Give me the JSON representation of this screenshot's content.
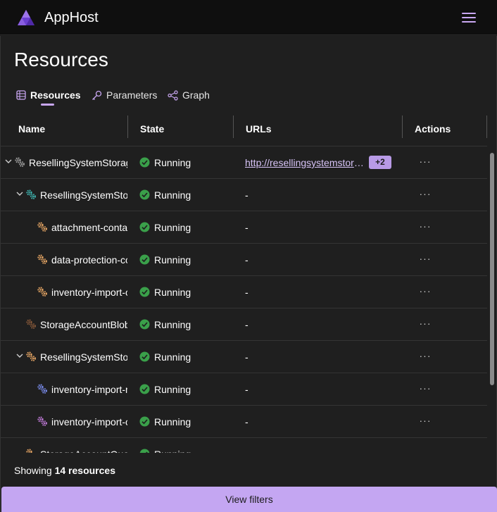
{
  "app": {
    "title": "AppHost"
  },
  "page": {
    "title": "Resources"
  },
  "tabs": [
    {
      "label": "Resources",
      "icon": "table-icon",
      "active": true
    },
    {
      "label": "Parameters",
      "icon": "key-icon",
      "active": false
    },
    {
      "label": "Graph",
      "icon": "graph-icon",
      "active": false
    }
  ],
  "columns": {
    "name": "Name",
    "state": "State",
    "urls": "URLs",
    "actions": "Actions"
  },
  "rows": [
    {
      "name": "ResellingSystemStorag",
      "state": "Running",
      "url": "http://resellingsystemstorage",
      "url_extra": "+2",
      "icon_color": "#a0a0a0",
      "expand": true,
      "level": 0
    },
    {
      "name": "ResellingSystemSto",
      "state": "Running",
      "url": "-",
      "icon_color": "#3fb6b2",
      "expand": true,
      "level": 1
    },
    {
      "name": "attachment-conta",
      "state": "Running",
      "url": "-",
      "icon_color": "#e8a765",
      "expand": false,
      "level": 2
    },
    {
      "name": "data-protection-cc",
      "state": "Running",
      "url": "-",
      "icon_color": "#e8a765",
      "expand": false,
      "level": 2
    },
    {
      "name": "inventory-import-c",
      "state": "Running",
      "url": "-",
      "icon_color": "#e8a765",
      "expand": false,
      "level": 2
    },
    {
      "name": "StorageAccountBlob",
      "state": "Running",
      "url": "-",
      "icon_color": "#8a5a3a",
      "expand": false,
      "level": 1
    },
    {
      "name": "ResellingSystemSto",
      "state": "Running",
      "url": "-",
      "icon_color": "#e8a765",
      "expand": true,
      "level": 1
    },
    {
      "name": "inventory-import-r",
      "state": "Running",
      "url": "-",
      "icon_color": "#7c8ef0",
      "expand": false,
      "level": 2
    },
    {
      "name": "inventory-import-c",
      "state": "Running",
      "url": "-",
      "icon_color": "#c07ad8",
      "expand": false,
      "level": 2
    },
    {
      "name": "StorageAccountQue",
      "state": "Running",
      "url": "-",
      "icon_color": "#e8a765",
      "expand": false,
      "level": 1
    }
  ],
  "actions_label": "···",
  "footer": {
    "showing_prefix": "Showing",
    "count_text": "14 resources",
    "filter_button": "View filters"
  },
  "colors": {
    "accent": "#c4a6f2",
    "running": "#3aa04a",
    "link": "#d8c4f8"
  }
}
